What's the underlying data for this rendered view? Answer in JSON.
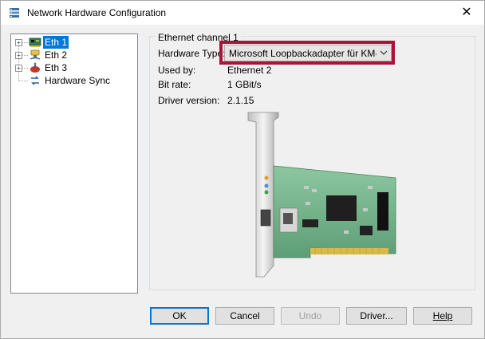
{
  "window": {
    "title": "Network Hardware Configuration",
    "close_label": "✕",
    "icon": "network-config-icon"
  },
  "tree": {
    "items": [
      {
        "label": "Eth 1",
        "icon": "network-card-icon",
        "selected": true,
        "expandable": true
      },
      {
        "label": "Eth 2",
        "icon": "wired-network-icon",
        "selected": false,
        "expandable": true
      },
      {
        "label": "Eth 3",
        "icon": "ethercat-icon",
        "selected": false,
        "expandable": true
      },
      {
        "label": "Hardware Sync",
        "icon": "sync-icon",
        "selected": false,
        "expandable": false
      }
    ]
  },
  "details": {
    "group_title": "Ethernet channel 1",
    "hardware_type_label": "Hardware Type:",
    "hardware_type_value": "Microsoft Loopbackadapter für KM-TEST",
    "used_by_label": "Used by:",
    "used_by_value": "Ethernet 2",
    "bit_rate_label": "Bit rate:",
    "bit_rate_value": "1 GBit/s",
    "driver_version_label": "Driver version:",
    "driver_version_value": "2.1.15",
    "image_icon": "network-card-image"
  },
  "buttons": {
    "ok": "OK",
    "cancel": "Cancel",
    "undo": "Undo",
    "driver": "Driver...",
    "help": "Help"
  },
  "colors": {
    "highlight": "#a5163a",
    "selection": "#0078d7",
    "pcb": "#6fae86"
  }
}
